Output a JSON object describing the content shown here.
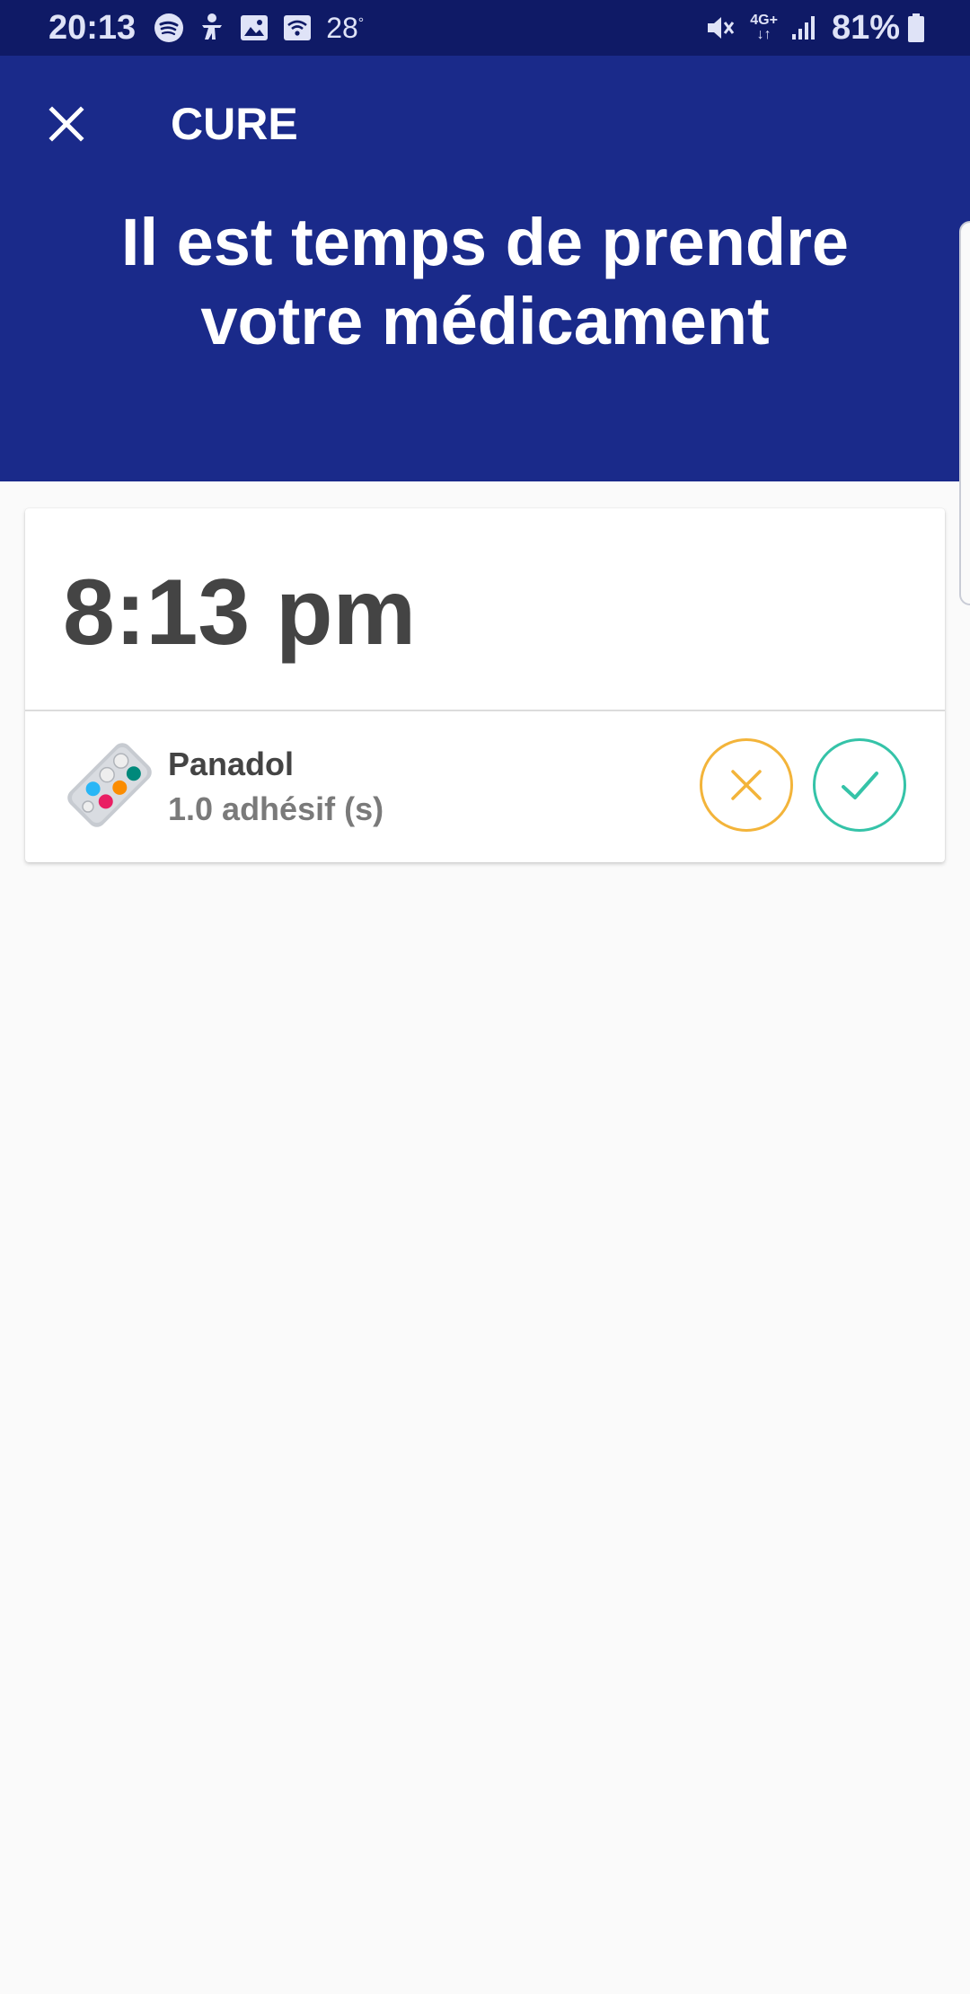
{
  "status_bar": {
    "time": "20:13",
    "temperature": "28",
    "temperature_unit": "°",
    "network": "4G+",
    "battery": "81%",
    "icons": [
      "spotify-icon",
      "accessibility-icon",
      "gallery-icon",
      "wifi-calling-icon",
      "mute-icon",
      "network-4g-icon",
      "signal-icon",
      "battery-icon"
    ]
  },
  "header": {
    "title": "CURE",
    "message": "Il est temps de prendre votre médicament",
    "close_icon": "close-icon"
  },
  "dose": {
    "time": "8:13 pm",
    "medication": {
      "name": "Panadol",
      "quantity": "1.0 adhésif (s)",
      "icon": "pill-blister-icon"
    },
    "actions": {
      "skip_icon": "close-icon",
      "take_icon": "check-icon"
    }
  },
  "colors": {
    "status_bar": "#0f1a66",
    "header": "#1a2a8a",
    "skip": "#f3b43a",
    "take": "#35c3a8",
    "background": "#fafafa"
  }
}
